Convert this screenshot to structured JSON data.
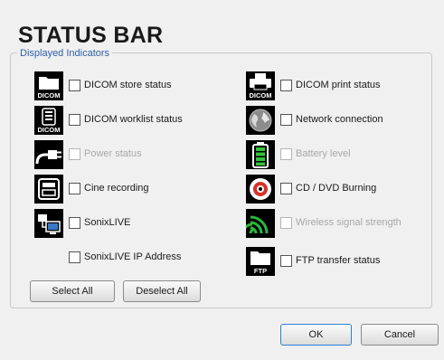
{
  "dialog": {
    "title": "STATUS BAR",
    "group_label": "Displayed Indicators"
  },
  "indicators": {
    "dicom_store": {
      "label": "DICOM store status",
      "enabled": true,
      "checked": false,
      "icon": "dicom-store-icon",
      "icon_text": "DICOM"
    },
    "dicom_print": {
      "label": "DICOM print status",
      "enabled": true,
      "checked": false,
      "icon": "dicom-print-icon",
      "icon_text": "DICOM"
    },
    "dicom_worklist": {
      "label": "DICOM worklist status",
      "enabled": true,
      "checked": false,
      "icon": "dicom-worklist-icon",
      "icon_text": "DICOM"
    },
    "network": {
      "label": "Network connection",
      "enabled": true,
      "checked": false,
      "icon": "globe-icon"
    },
    "power": {
      "label": "Power status",
      "enabled": false,
      "checked": false,
      "icon": "power-plug-icon"
    },
    "battery": {
      "label": "Battery level",
      "enabled": false,
      "checked": false,
      "icon": "battery-icon"
    },
    "cine": {
      "label": "Cine recording",
      "enabled": true,
      "checked": false,
      "icon": "cine-recording-icon"
    },
    "cd_dvd": {
      "label": "CD / DVD Burning",
      "enabled": true,
      "checked": false,
      "icon": "disc-icon"
    },
    "sonixlive": {
      "label": "SonixLIVE",
      "enabled": true,
      "checked": false,
      "icon": "sonixlive-icon"
    },
    "wireless": {
      "label": "Wireless signal strength",
      "enabled": false,
      "checked": false,
      "icon": "wireless-signal-icon"
    },
    "sonixlive_ip": {
      "label": "SonixLIVE IP Address",
      "enabled": true,
      "checked": false
    },
    "ftp": {
      "label": "FTP transfer status",
      "enabled": true,
      "checked": false,
      "icon": "ftp-folder-icon",
      "icon_text": "FTP"
    }
  },
  "buttons": {
    "select_all": "Select All",
    "deselect_all": "Deselect All",
    "ok": "OK",
    "cancel": "Cancel"
  },
  "colors": {
    "group_label": "#2f5ea8",
    "disabled_text": "#a8a8a8",
    "default_button_border": "#2f7fd1"
  }
}
